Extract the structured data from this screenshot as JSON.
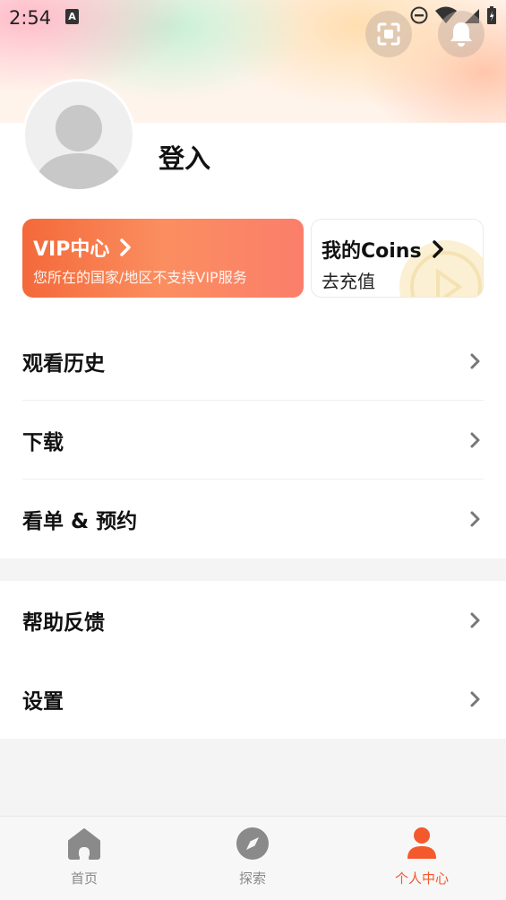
{
  "status_bar": {
    "time": "2:54",
    "notification_letter": "A"
  },
  "colors": {
    "accent": "#f4592d",
    "vip_gradient_start": "#f4693a",
    "vip_gradient_end": "#fb7e6a",
    "inactive_icon": "#8a8a8a"
  },
  "profile": {
    "login_label": "登入"
  },
  "vip_card": {
    "title": "VIP中心",
    "subtitle": "您所在的国家/地区不支持VIP服务"
  },
  "coins_card": {
    "title": "我的Coins",
    "subtitle": "去充值"
  },
  "menu_group_1": [
    {
      "label": "观看历史"
    },
    {
      "label": "下载"
    },
    {
      "label": "看单 & 预约"
    }
  ],
  "menu_group_2": [
    {
      "label": "帮助反馈"
    },
    {
      "label": "设置"
    }
  ],
  "bottom_nav": [
    {
      "label": "首页",
      "icon": "home-icon",
      "active": false
    },
    {
      "label": "探索",
      "icon": "compass-icon",
      "active": false
    },
    {
      "label": "个人中心",
      "icon": "person-icon",
      "active": true
    }
  ]
}
